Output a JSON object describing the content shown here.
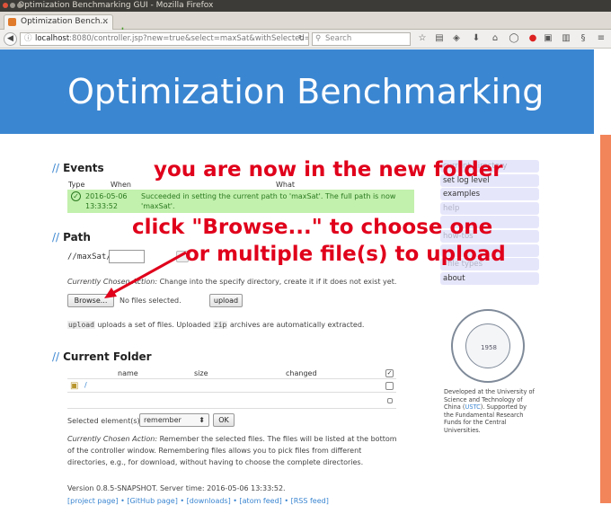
{
  "window": {
    "title": "Optimization Benchmarking GUI - Mozilla Firefox"
  },
  "tab": {
    "label": "Optimization Bench...",
    "close": "×"
  },
  "newtab": "+",
  "url": {
    "host": "localhost",
    "rest": ":8080/controller.jsp?new=true&select=maxSat&withSelected=cd"
  },
  "search": {
    "placeholder": "Search"
  },
  "banner": {
    "title": "Optimization Benchmarking"
  },
  "events": {
    "heading": "Events",
    "columns": {
      "type": "Type",
      "when": "When",
      "what": "What"
    },
    "row": {
      "time": "2016-05-06 13:33:52",
      "message": "Succeeded in setting the current path to 'maxSat'. The full path is now 'maxSat'."
    }
  },
  "path": {
    "heading": "Path",
    "current": "//maxSat/",
    "action_label": "Currently Chosen Action:",
    "action_text": "Change into the specify directory, create it if it does not exist yet.",
    "browse": "Browse...",
    "no_files": "No files selected.",
    "upload": "upload",
    "upload_code": "upload",
    "upload_desc1": "uploads a set of files. Uploaded",
    "zip_code": "zip",
    "upload_desc2": "archives are automatically extracted."
  },
  "current_folder": {
    "heading": "Current Folder",
    "columns": {
      "name": "name",
      "size": "size",
      "changed": "changed"
    },
    "row": {
      "name": "/"
    },
    "selected_label": "Selected element(s):",
    "select_value": "remember",
    "ok": "OK",
    "action_label": "Currently Chosen Action:",
    "action_text": "Remember the selected files. The files will be listed at the bottom of the controller window. Remembering files allows you to pick files from different directories, e.g., for download, without having to choose the complete directories."
  },
  "footer": {
    "version": "Version 0.8.5-SNAPSHOT. Server time: 2016-05-06 13:33:52.",
    "links": "[project page] • [GitHub page] • [downloads] • [atom feed] • [RSS feed]"
  },
  "menu": [
    {
      "label": "current directory",
      "faded": true
    },
    {
      "label": "set log level",
      "faded": false
    },
    {
      "label": "examples",
      "faded": false
    },
    {
      "label": "help",
      "faded": true
    },
    {
      "label": "",
      "faded": true
    },
    {
      "label": "how-tos",
      "faded": true
    },
    {
      "label": "",
      "faded": true
    },
    {
      "label": "file types",
      "faded": true
    },
    {
      "label": "about",
      "faded": false
    }
  ],
  "seal": {
    "year": "1958"
  },
  "university": {
    "text1": "Developed at the University of Science and Technology of China (",
    "link": "USTC",
    "text2": "). Supported by the Fundamental Research Funds for the Central Universities."
  },
  "annotations": {
    "line1": "you are now in the new folder",
    "line2": "click \"Browse...\" to choose one",
    "line3": "or multiple file(s) to upload"
  },
  "colors": {
    "banner": "#3b86d1",
    "annotation": "#e0001b",
    "event_bg": "#c2f0ad",
    "menu_bg": "#e6e6fb"
  }
}
